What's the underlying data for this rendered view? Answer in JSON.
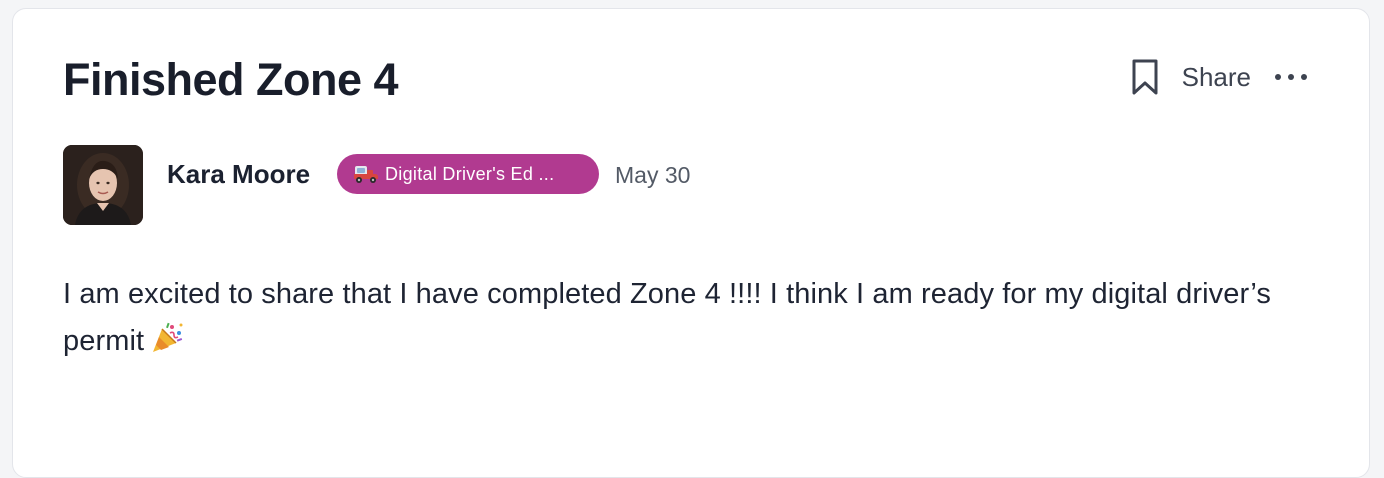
{
  "post": {
    "title": "Finished Zone 4",
    "actions": {
      "bookmark_icon": "bookmark-icon",
      "share_label": "Share",
      "more_icon": "more-horizontal-icon"
    },
    "author": {
      "name": "Kara Moore",
      "avatar": "avatar-photo"
    },
    "group_badge": {
      "label": "Digital Driver's Ed ...",
      "icon": "car-icon",
      "color": "#b13a90"
    },
    "date": "May 30",
    "body": "I am excited to share that I have completed Zone 4 !!!! I think I am ready for my digital driver’s permit",
    "body_emoji": "party-popper-icon"
  }
}
